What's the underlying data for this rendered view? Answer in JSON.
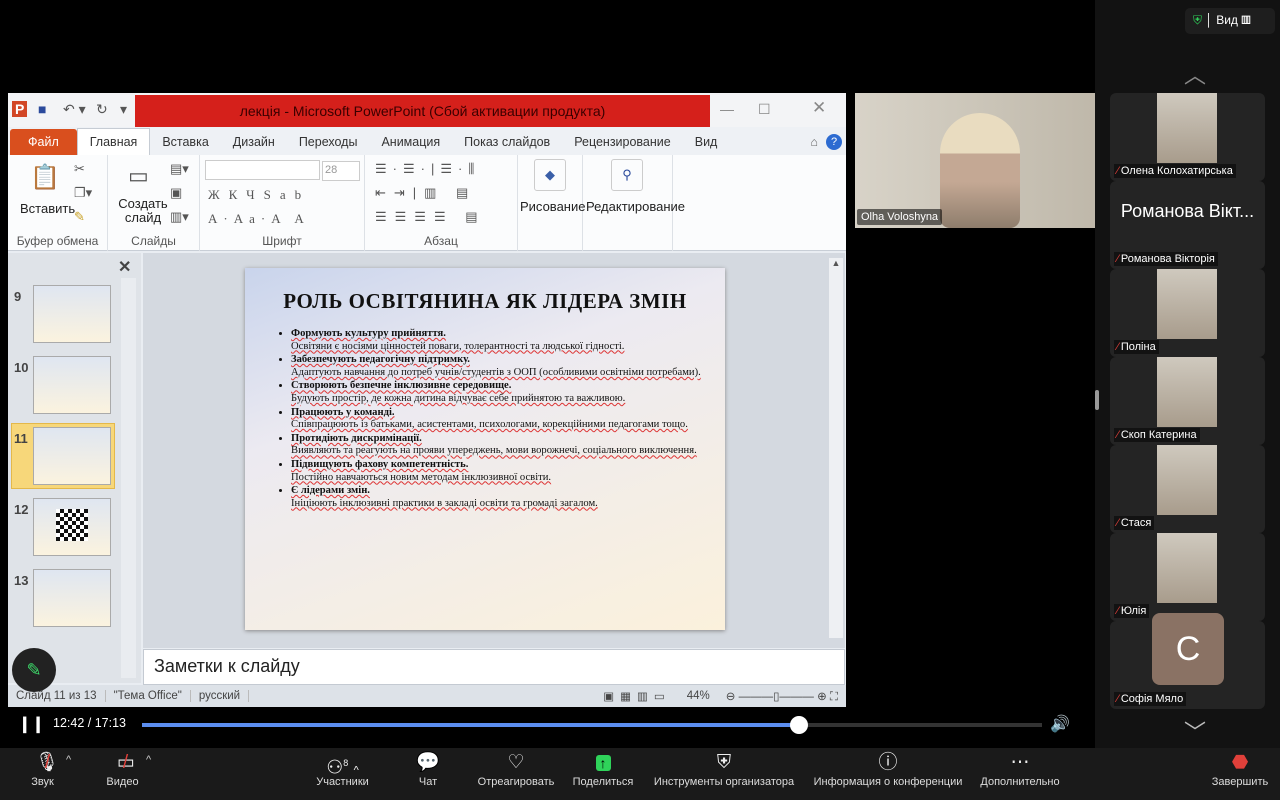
{
  "ppt": {
    "title": "лекція  -  Microsoft PowerPoint (Сбой активации продукта)",
    "tabs": [
      "Файл",
      "Главная",
      "Вставка",
      "Дизайн",
      "Переходы",
      "Анимация",
      "Показ слайдов",
      "Рецензирование",
      "Вид"
    ],
    "ribbon": {
      "paste": "Вставить",
      "new_slide": "Создать слайд",
      "font_size": "28",
      "drawing": "Рисование",
      "editing": "Редактирование",
      "groups": [
        "Буфер обмена",
        "Слайды",
        "Шрифт",
        "Абзац"
      ]
    },
    "thumbnails": [
      "9",
      "10",
      "11",
      "12",
      "13"
    ],
    "current_slide": "11",
    "slide": {
      "title": "РОЛЬ ОСВІТЯНИНА  ЯК ЛІДЕРА ЗМІН",
      "bullets": [
        {
          "head": "Формують  культуру  прийняття.",
          "body": "Освітяни  є носіями цінностей  поваги, толерантності  та  людської  гідності."
        },
        {
          "head": "Забезпечують  педагогічну  підтримку.",
          "body": "Адаптують  навчання  до потреб учнів/студентів  з ООП (особливими освітніми потребами)."
        },
        {
          "head": "Створюють  безпечне  інклюзивне  середовище.",
          "body": "Будують простір, де кожна дитина  відчуває себе прийнятою та важливою."
        },
        {
          "head": "Працюють  у команді.",
          "body": "Співпрацюють  із  батьками, асистентами, психологами,  корекційними педагогами тощо."
        },
        {
          "head": "Протидіють  дискримінації.",
          "body": "Виявляють  та реагують на прояви упереджень, мови ворожнечі, соціального виключення."
        },
        {
          "head": "Підвищують  фахову  компетентність.",
          "body": "Постійно  навчаються  новим методам інклюзивної  освіти."
        },
        {
          "head": "Є лідерами  змін.",
          "body": "Ініціюють  інклюзивні  практики  в закладі  освіти  та громаді загалом."
        }
      ]
    },
    "notes": "Заметки к слайду",
    "status": {
      "slide": "Слайд 11 из 13",
      "theme": "\"Тема Office\"",
      "lang": "русский",
      "zoom": "44%"
    }
  },
  "presenter": "Olha Voloshyna",
  "playback": {
    "time": "12:42 / 17:13",
    "progress": 0.73
  },
  "top": {
    "view": "Вид"
  },
  "participants": [
    {
      "name": "Олена Колохатирська",
      "video": true
    },
    {
      "name": "Романова Вікторія",
      "big": "Романова Вікт...",
      "video": false
    },
    {
      "name": "Поліна",
      "video": true
    },
    {
      "name": "Скоп Катерина",
      "video": true
    },
    {
      "name": "Стася",
      "video": true
    },
    {
      "name": "Юлія",
      "video": true
    },
    {
      "name": "Софія Мяло",
      "initial": "C",
      "video": false
    }
  ],
  "toolbar": {
    "audio": "Звук",
    "video": "Видео",
    "participants": "Участники",
    "participants_count": "8",
    "chat": "Чат",
    "react": "Отреагировать",
    "share": "Поделиться",
    "host_tools": "Инструменты организатора",
    "info": "Информация о конференции",
    "more": "Дополнительно",
    "end": "Завершить"
  },
  "colors": {
    "ppt_red": "#d5201b",
    "share_green": "#2fd35a",
    "progress": "#5b8def"
  }
}
